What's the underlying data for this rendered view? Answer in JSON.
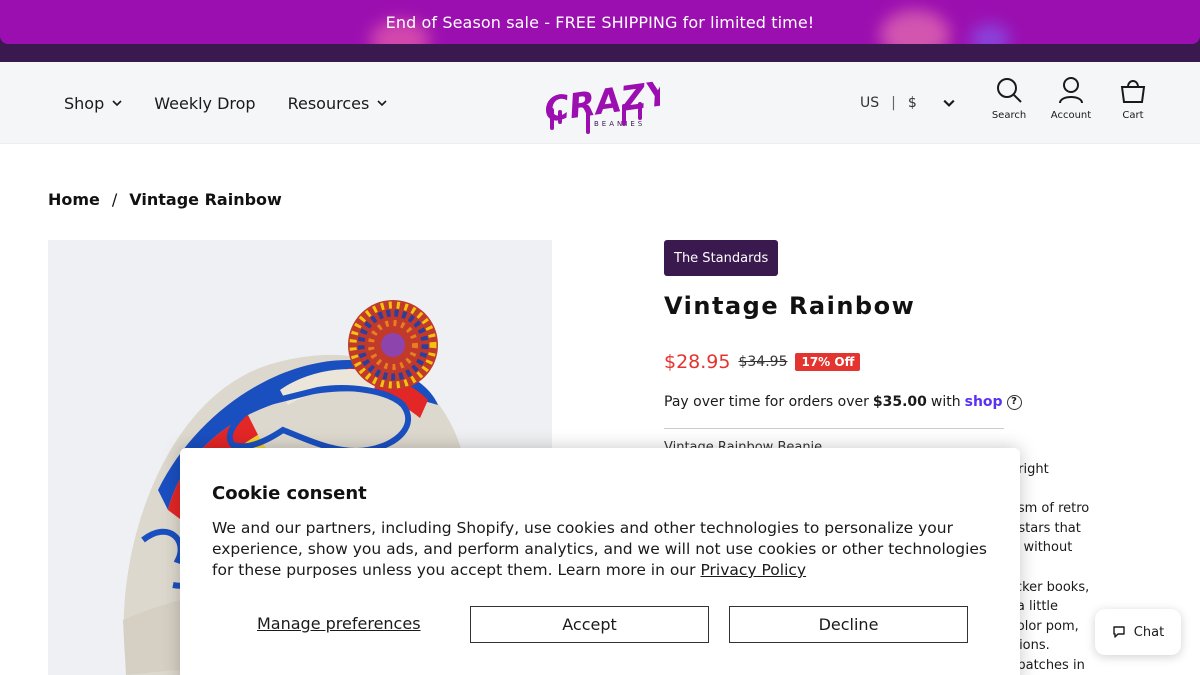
{
  "announcement": {
    "text": "End of Season sale - FREE SHIPPING for limited time!"
  },
  "nav": {
    "shop": "Shop",
    "weekly_drop": "Weekly Drop",
    "resources": "Resources"
  },
  "logo": {
    "word": "CRAZY",
    "sub": "BEANIES"
  },
  "locale": {
    "country": "US",
    "separator": "|",
    "currency": "$"
  },
  "header_icons": {
    "search": "Search",
    "account": "Account",
    "cart": "Cart"
  },
  "breadcrumb": {
    "home": "Home",
    "separator": "/",
    "current": "Vintage Rainbow"
  },
  "product": {
    "collection_tag": "The Standards",
    "title": "Vintage Rainbow",
    "price": "$28.95",
    "compare_price": "$34.95",
    "discount": "17% Off",
    "installments_prefix": "Pay over time for orders over",
    "installments_amount": "$35.00",
    "installments_with": "with",
    "installments_brand": "shop",
    "description_visible_start": "Vintage Rainbow Beanie",
    "description_fragments": [
      "e right",
      "nism of retro",
      "d stars that",
      "nt without",
      "ricker books,",
      "s a little",
      "icolor pom,",
      "ations.",
      "ll batches in"
    ]
  },
  "cookie": {
    "title": "Cookie consent",
    "body": "We and our partners, including Shopify, use cookies and other technologies to personalize your experience, show you ads, and perform analytics, and we will not use cookies or other technologies for these purposes unless you accept them. Learn more in our ",
    "policy_link": "Privacy Policy",
    "manage": "Manage preferences",
    "accept": "Accept",
    "decline": "Decline"
  },
  "chat": {
    "label": "Chat"
  },
  "colors": {
    "brand_purple": "#9b0fb0",
    "dark_purple": "#3a1a4e",
    "sale_red": "#e3342f",
    "shop_blue": "#5a31f4"
  }
}
